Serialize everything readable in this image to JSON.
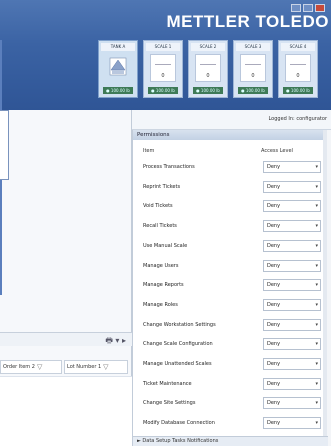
{
  "brand": "METTLER TOLEDO",
  "scales": [
    {
      "name": "TANK A",
      "value": "",
      "footer": "● 100.00 lb",
      "type": "tank"
    },
    {
      "name": "SCALE 1",
      "value": "0",
      "footer": "● 100.00 lb",
      "type": "scale"
    },
    {
      "name": "SCALE 2",
      "value": "0",
      "footer": "● 100.00 lb",
      "type": "scale"
    },
    {
      "name": "SCALE 3",
      "value": "0",
      "footer": "● 100.00 lb",
      "type": "scale"
    },
    {
      "name": "SCALE 4",
      "value": "0",
      "footer": "● 100.00 lb",
      "type": "scale"
    }
  ],
  "infobar": {
    "logged": "Logged In: configurator"
  },
  "left": {
    "columns": [
      "Order Item 2",
      "Lot Number 1"
    ]
  },
  "permissions": {
    "title": "Permissions",
    "col_item": "Item",
    "col_access": "Access Level",
    "rows": [
      {
        "item": "Process Transactions",
        "access": "Deny"
      },
      {
        "item": "Reprint Tickets",
        "access": "Deny"
      },
      {
        "item": "Void Tickets",
        "access": "Deny"
      },
      {
        "item": "Recall Tickets",
        "access": "Deny"
      },
      {
        "item": "Use Manual Scale",
        "access": "Deny"
      },
      {
        "item": "Manage Users",
        "access": "Deny"
      },
      {
        "item": "Manage Reports",
        "access": "Deny"
      },
      {
        "item": "Manage Roles",
        "access": "Deny"
      },
      {
        "item": "Change Workstation Settings",
        "access": "Deny"
      },
      {
        "item": "Change Scale Configuration",
        "access": "Deny"
      },
      {
        "item": "Manage Unattended Scales",
        "access": "Deny"
      },
      {
        "item": "Ticket Maintenance",
        "access": "Deny"
      },
      {
        "item": "Change Site Settings",
        "access": "Deny"
      },
      {
        "item": "Modify Database Connection",
        "access": "Deny"
      }
    ],
    "status": "► Data Setup  Tasks  Notifications"
  }
}
